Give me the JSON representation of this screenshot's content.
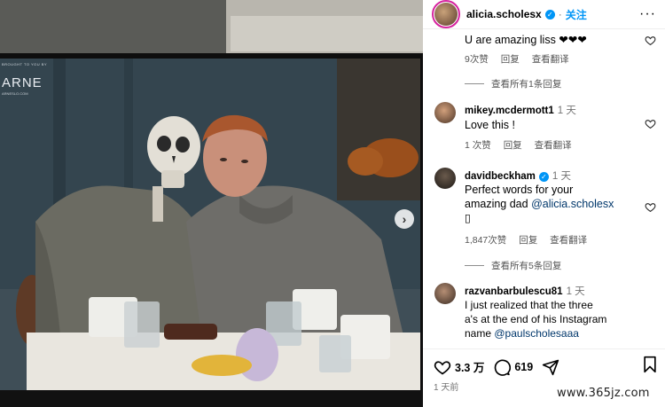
{
  "post": {
    "author": "alicia.scholesx",
    "follow_label": "关注",
    "like_count": "3.3 万",
    "comment_count": "619",
    "posted_ago": "1 天前"
  },
  "photo": {
    "brand_small": "BROUGHT TO YOU BY",
    "brand_big": "ARNE",
    "brand_url": "ARNESLO.COM"
  },
  "comments": [
    {
      "text": "U are amazing liss ❤❤❤",
      "likes": "9次赞",
      "reply_label": "回复",
      "translate_label": "查看翻译"
    },
    {
      "view_replies": "查看所有1条回复"
    },
    {
      "username": "mikey.mcdermott1",
      "time": "1 天",
      "text": "Love this !",
      "likes": "1 次赞",
      "reply_label": "回复",
      "translate_label": "查看翻译"
    },
    {
      "username": "davidbeckham",
      "time": "1 天",
      "text_line1": "Perfect words for your",
      "text_line2": "amazing dad",
      "mention": "@alicia.scholesx",
      "text_line3": "▯",
      "likes": "1,847次赞",
      "reply_label": "回复",
      "translate_label": "查看翻译"
    },
    {
      "view_replies": "查看所有5条回复"
    },
    {
      "username": "razvanbarbulescu81",
      "time": "1 天",
      "text_line1": "I just realized that the three",
      "text_line2": "a's at the end of his Instagram",
      "text_line3_prefix": "name",
      "mention": "@paulscholesaaa"
    }
  ],
  "watermark": "www.365jz.com",
  "colors": {
    "accent": "#0095f6",
    "mention": "#00376b",
    "story_ring": "#d6249f"
  }
}
